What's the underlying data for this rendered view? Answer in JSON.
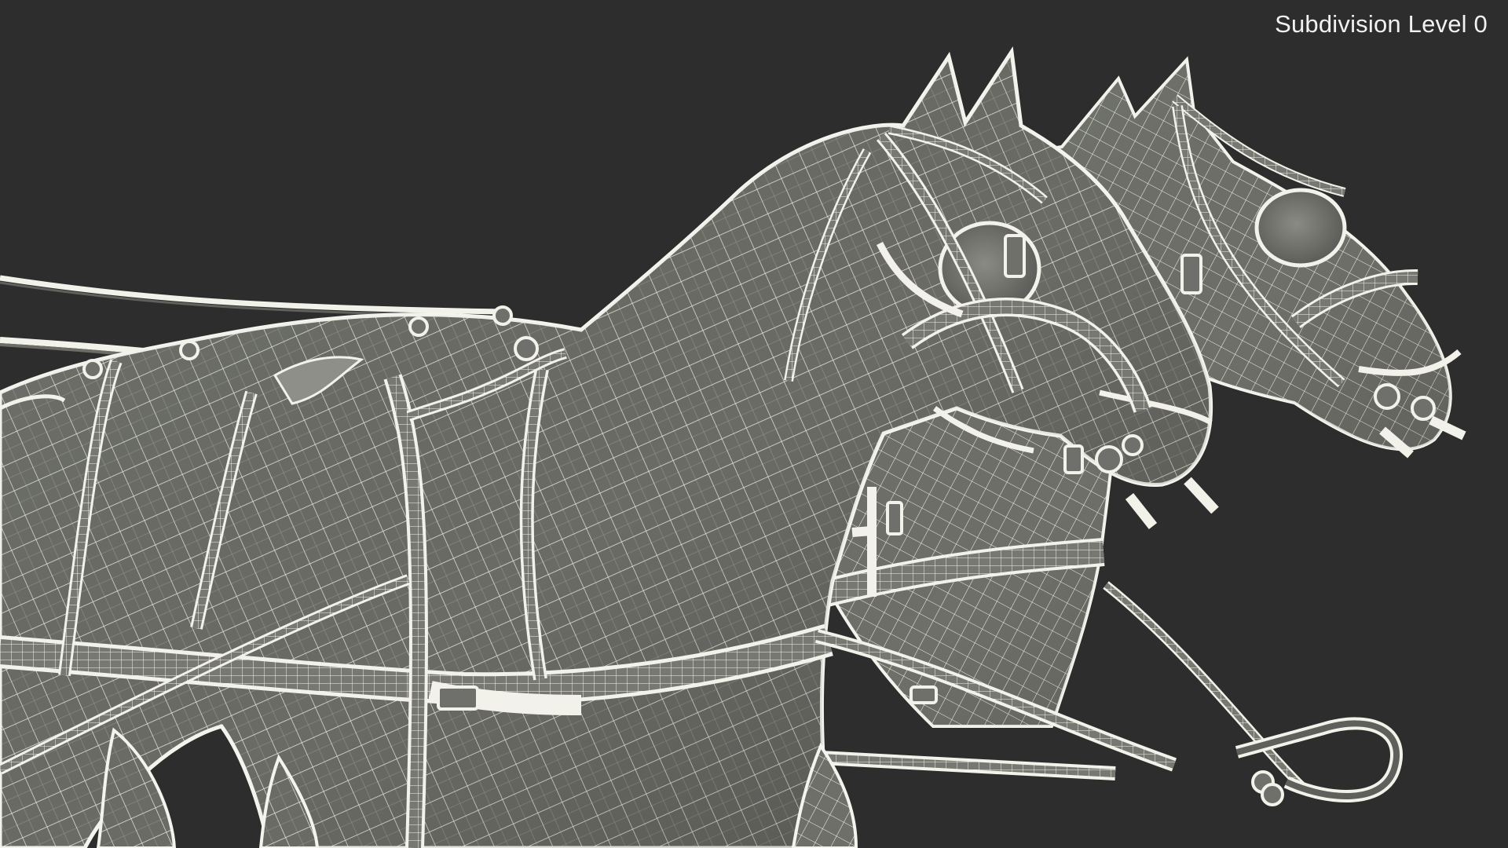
{
  "viewport": {
    "overlay_label": "Subdivision Level 0",
    "background_color": "#2c2d2c",
    "mesh_surface_color": "#6c6d67",
    "wireframe_color": "#f2f2ea",
    "subject": "two harnessed horse heads and shoulders in wireframe render"
  }
}
